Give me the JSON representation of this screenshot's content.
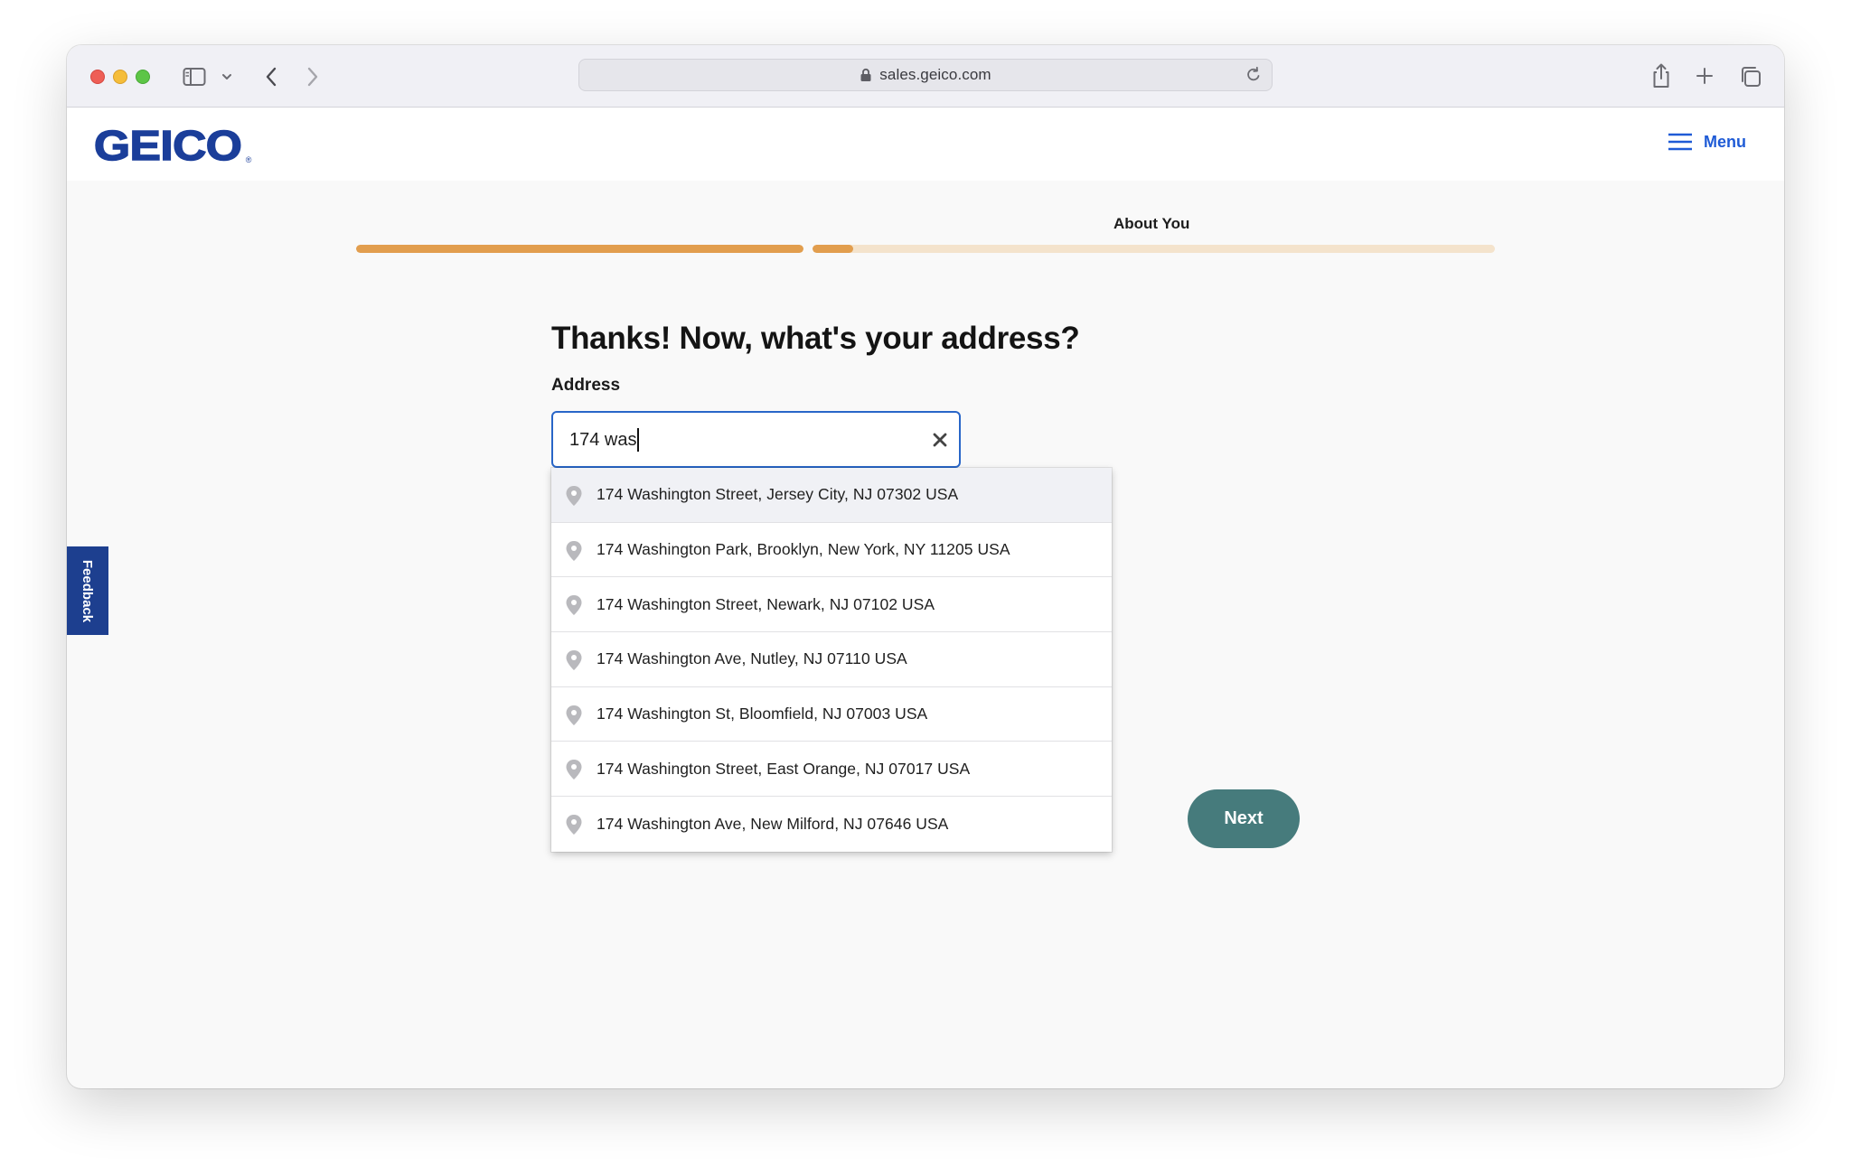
{
  "browser": {
    "url": "sales.geico.com"
  },
  "header": {
    "logo_text": "GEICO",
    "logo_reg": "®",
    "menu_label": "Menu"
  },
  "feedback": {
    "label": "Feedback"
  },
  "progress": {
    "current_step_label": "About You",
    "segments": [
      {
        "fill_fraction": 1.0
      },
      {
        "fill_fraction": 0.06
      }
    ]
  },
  "form": {
    "title": "Thanks! Now, what's your address?",
    "address_label": "Address",
    "address_value": "174 was",
    "suggestions": [
      "174 Washington Street, Jersey City, NJ 07302 USA",
      "174 Washington Park, Brooklyn, New York, NY 11205 USA",
      "174 Washington Street, Newark, NJ 07102 USA",
      "174 Washington Ave, Nutley, NJ 07110 USA",
      "174 Washington St, Bloomfield, NJ 07003 USA",
      "174 Washington Street, East Orange, NJ 07017 USA",
      "174 Washington Ave, New Milford, NJ 07646 USA"
    ],
    "next_label": "Next"
  },
  "colors": {
    "brand_blue": "#1b3e9a",
    "link_blue": "#1f5bd6",
    "progress_fill": "#e29e4e",
    "progress_track": "#f4e3cc",
    "next_button": "#467b7c"
  }
}
